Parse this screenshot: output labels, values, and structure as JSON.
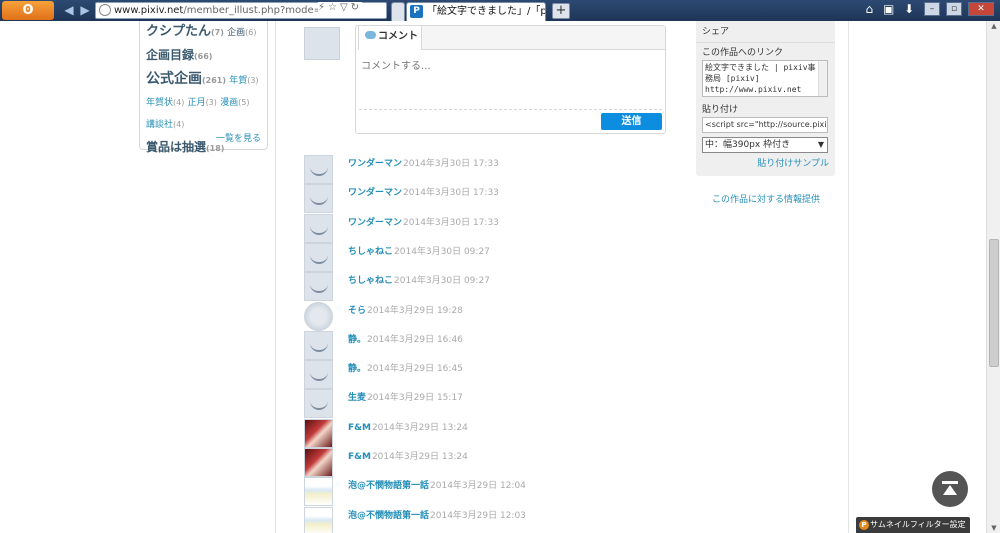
{
  "browser": {
    "menu_label": "Firefox",
    "url_host": "www.pixiv.net",
    "url_path": "/member_illust.php?mode=n",
    "active_tab_title": "「絵文字できました」/「pixi...",
    "favicon_letter": "P",
    "new_tab": "+"
  },
  "tags": [
    {
      "label": "クシプたん",
      "count": "(7)",
      "size": "big"
    },
    {
      "label": "企画",
      "count": "(6)",
      "size": "sm-dark"
    },
    {
      "label": "企画目録",
      "count": "(66)",
      "size": "mid"
    },
    {
      "label": "公式企画",
      "count": "(261)",
      "size": "xl"
    },
    {
      "label": "年賀",
      "count": "(3)",
      "size": "sm"
    },
    {
      "label": "年賀状",
      "count": "(4)",
      "size": "sm"
    },
    {
      "label": "正月",
      "count": "(3)",
      "size": "sm"
    },
    {
      "label": "漫画",
      "count": "(5)",
      "size": "sm"
    },
    {
      "label": "講談社",
      "count": "(4)",
      "size": "sm"
    },
    {
      "label": "賞品は抽選",
      "count": "(18)",
      "size": "mid"
    }
  ],
  "tags_see_all": "一覧を見る",
  "comment_form": {
    "tab_label": "コメント",
    "placeholder": "コメントする...",
    "send_label": "送信"
  },
  "comments": [
    {
      "name": "ワンダーマン",
      "date": "2014年3月30日 17:33",
      "avatar": "default"
    },
    {
      "name": "ワンダーマン",
      "date": "2014年3月30日 17:33",
      "avatar": "default"
    },
    {
      "name": "ワンダーマン",
      "date": "2014年3月30日 17:33",
      "avatar": "default"
    },
    {
      "name": "ちしゃねこ",
      "date": "2014年3月30日 09:27",
      "avatar": "default"
    },
    {
      "name": "ちしゃねこ",
      "date": "2014年3月30日 09:27",
      "avatar": "default"
    },
    {
      "name": "そら",
      "date": "2014年3月29日 19:28",
      "avatar": "round"
    },
    {
      "name": "静。",
      "date": "2014年3月29日 16:46",
      "avatar": "default"
    },
    {
      "name": "静。",
      "date": "2014年3月29日 16:45",
      "avatar": "default"
    },
    {
      "name": "生麦",
      "date": "2014年3月29日 15:17",
      "avatar": "default"
    },
    {
      "name": "F&M",
      "date": "2014年3月29日 13:24",
      "avatar": "photo"
    },
    {
      "name": "F&M",
      "date": "2014年3月29日 13:24",
      "avatar": "photo"
    },
    {
      "name": "泡@不憫物語第一話",
      "date": "2014年3月29日 12:04",
      "avatar": "sketch"
    },
    {
      "name": "泡@不憫物語第一話",
      "date": "2014年3月29日 12:03",
      "avatar": "sketch"
    }
  ],
  "share": {
    "title": "シェア",
    "link_label": "この作品へのリンク",
    "link_value": "絵文字できました | pixiv事務局 [pixiv] http://www.pixiv.net",
    "embed_label": "貼り付け",
    "embed_value": "<script src=\"http://source.pixiv.n",
    "size_option": "中：幅390px 枠付き",
    "sample_link": "貼り付けサンプル"
  },
  "info_link": "この作品に対する情報提供",
  "thumbnail_filter": "サムネイルフィルター設定",
  "colors": {
    "link": "#258fb8",
    "send_button": "#0d8de0",
    "chrome": "#1e3556"
  }
}
